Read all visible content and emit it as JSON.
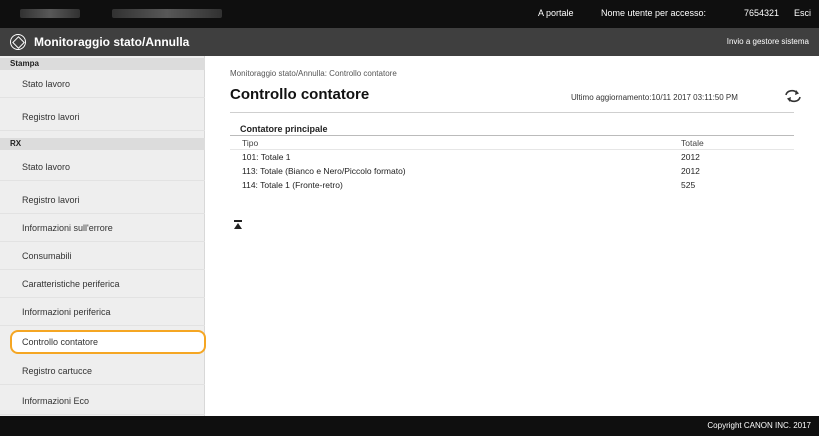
{
  "topbar": {
    "portal_link": "A portale",
    "user_label": "Nome utente per accesso:",
    "user_id": "7654321",
    "logout": "Esci"
  },
  "header": {
    "title": "Monitoraggio stato/Annulla",
    "manager_link": "Invio a gestore sistema"
  },
  "sidebar": {
    "sections": [
      {
        "label": "Stampa",
        "items": [
          "Stato lavoro",
          "Registro lavori"
        ]
      },
      {
        "label": "RX",
        "items": [
          "Stato lavoro",
          "Registro lavori",
          "Informazioni sull'errore",
          "Consumabili",
          "Caratteristiche periferica",
          "Informazioni periferica",
          "Controllo contatore",
          "Registro cartucce",
          "Informazioni Eco"
        ]
      }
    ],
    "selected": "Controllo contatore"
  },
  "main": {
    "breadcrumb": "Monitoraggio stato/Annulla: Controllo contatore",
    "title": "Controllo contatore",
    "updated": "Ultimo aggiornamento:10/11 2017 03:11:50 PM",
    "table": {
      "title": "Contatore principale",
      "headers": [
        "Tipo",
        "Totale"
      ],
      "rows": [
        [
          "101: Totale 1",
          "2012"
        ],
        [
          "113: Totale (Bianco e Nero/Piccolo formato)",
          "2012"
        ],
        [
          "114: Totale 1 (Fronte-retro)",
          "525"
        ]
      ]
    }
  },
  "footer": {
    "copyright": "Copyright CANON INC. 2017"
  }
}
